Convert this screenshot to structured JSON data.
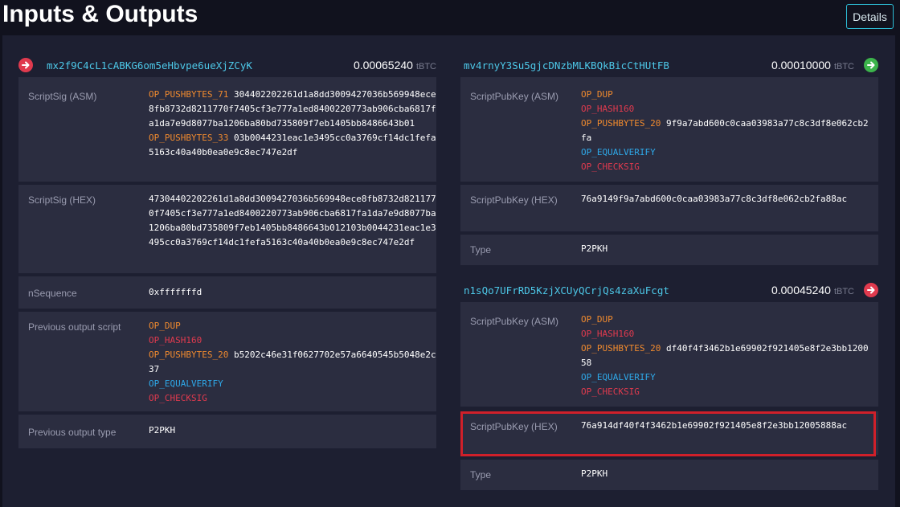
{
  "header": {
    "title": "Inputs & Outputs",
    "details_label": "Details"
  },
  "colors": {
    "background": "#11121e",
    "panel": "#1d1f31",
    "row": "#2b2d40",
    "address": "#4dc8e8",
    "op_orange": "#f08a2e",
    "op_red": "#e03a4e",
    "op_blue": "#2ea8e8",
    "highlight": "#d0202a"
  },
  "input": {
    "icon": "arrow-right-icon",
    "address": "mx2f9C4cL1cABKG6om5eHbvpe6ueXjZCyK",
    "amount": "0.00065240",
    "unit": "tBTC",
    "scriptsig_asm_label": "ScriptSig (ASM)",
    "scriptsig_asm": [
      {
        "op": "OP_PUSHBYTES_71",
        "color": "orange",
        "data": "304402202261d1a8dd3009427036b569948ece8fb8732d8211770f7405cf3e777a1ed8400220773ab906cba6817fa1da7e9d8077ba1206ba80bd735809f7eb1405bb8486643b01"
      },
      {
        "op": "OP_PUSHBYTES_33",
        "color": "orange",
        "data": "03b0044231eac1e3495cc0a3769cf14dc1fefa5163c40a40b0ea0e9c8ec747e2df"
      }
    ],
    "scriptsig_hex_label": "ScriptSig (HEX)",
    "scriptsig_hex": "47304402202261d1a8dd3009427036b569948ece8fb8732d8211770f7405cf3e777a1ed8400220773ab906cba6817fa1da7e9d8077ba1206ba80bd735809f7eb1405bb8486643b012103b0044231eac1e3495cc0a3769cf14dc1fefa5163c40a40b0ea0e9c8ec747e2df",
    "nsequence_label": "nSequence",
    "nsequence": "0xfffffffd",
    "prev_script_label": "Previous output script",
    "prev_script": [
      {
        "op": "OP_DUP",
        "color": "orange",
        "data": ""
      },
      {
        "op": "OP_HASH160",
        "color": "red",
        "data": ""
      },
      {
        "op": "OP_PUSHBYTES_20",
        "color": "orange",
        "data": "b5202c46e31f0627702e57a6640545b5048e2c37"
      },
      {
        "op": "OP_EQUALVERIFY",
        "color": "blue",
        "data": ""
      },
      {
        "op": "OP_CHECKSIG",
        "color": "red",
        "data": ""
      }
    ],
    "prev_type_label": "Previous output type",
    "prev_type": "P2PKH"
  },
  "outputs": [
    {
      "address": "mv4rnyY3Su5gjcDNzbMLKBQkBicCtHUtFB",
      "amount": "0.00010000",
      "unit": "tBTC",
      "icon": "arrow-right-icon",
      "status": "green",
      "asm_label": "ScriptPubKey (ASM)",
      "asm": [
        {
          "op": "OP_DUP",
          "color": "orange",
          "data": ""
        },
        {
          "op": "OP_HASH160",
          "color": "red",
          "data": ""
        },
        {
          "op": "OP_PUSHBYTES_20",
          "color": "orange",
          "data": "9f9a7abd600c0caa03983a77c8c3df8e062cb2fa"
        },
        {
          "op": "OP_EQUALVERIFY",
          "color": "blue",
          "data": ""
        },
        {
          "op": "OP_CHECKSIG",
          "color": "red",
          "data": ""
        }
      ],
      "hex_label": "ScriptPubKey (HEX)",
      "hex": "76a9149f9a7abd600c0caa03983a77c8c3df8e062cb2fa88ac",
      "type_label": "Type",
      "type": "P2PKH"
    },
    {
      "address": "n1sQo7UFrRD5KzjXCUyQCrjQs4zaXuFcgt",
      "amount": "0.00045240",
      "unit": "tBTC",
      "icon": "arrow-right-icon",
      "status": "red",
      "asm_label": "ScriptPubKey (ASM)",
      "asm": [
        {
          "op": "OP_DUP",
          "color": "orange",
          "data": ""
        },
        {
          "op": "OP_HASH160",
          "color": "red",
          "data": ""
        },
        {
          "op": "OP_PUSHBYTES_20",
          "color": "orange",
          "data": "df40f4f3462b1e69902f921405e8f2e3bb120058"
        },
        {
          "op": "OP_EQUALVERIFY",
          "color": "blue",
          "data": ""
        },
        {
          "op": "OP_CHECKSIG",
          "color": "red",
          "data": ""
        }
      ],
      "hex_label": "ScriptPubKey (HEX)",
      "hex": "76a914df40f4f3462b1e69902f921405e8f2e3bb12005888ac",
      "type_label": "Type",
      "type": "P2PKH"
    }
  ]
}
